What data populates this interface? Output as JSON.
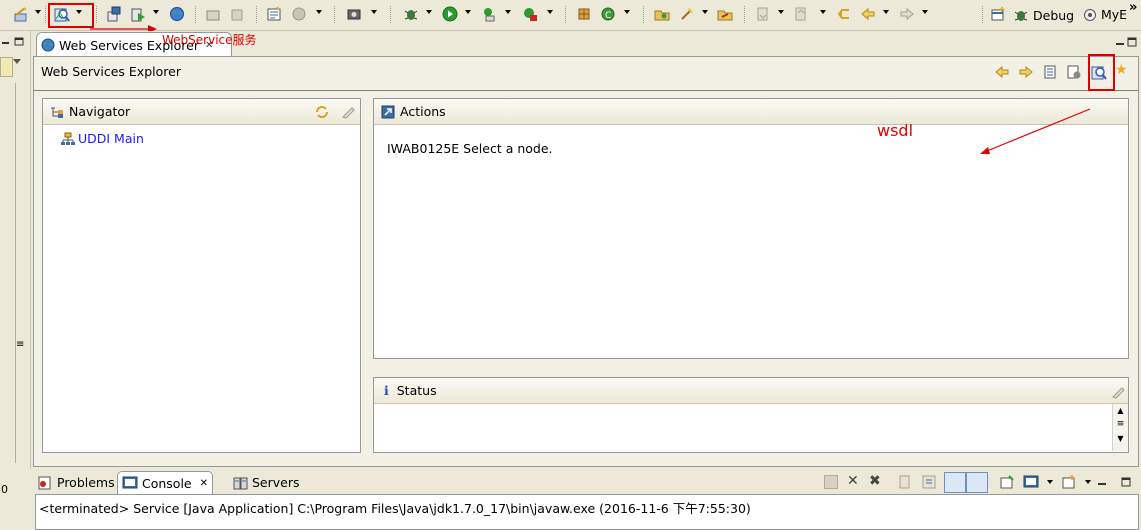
{
  "toolbar": {
    "perspectives": {
      "debug_label": "Debug",
      "mye_label": "MyE",
      "overflow_label": "»"
    },
    "icons": [
      "new-wizard-icon",
      "web-services-explorer-icon",
      "deploy-icon",
      "run-server-icon",
      "globe-icon",
      "debug-icon",
      "run-icon",
      "external-tools-icon",
      "coverage-icon",
      "open-type-icon",
      "open-task-icon",
      "annotation-icon",
      "back-icon",
      "forward-icon"
    ]
  },
  "editor": {
    "tab_title": "Web Services Explorer",
    "tab_close": "✕",
    "header_title": "Web Services Explorer",
    "navigator": {
      "title": "Navigator",
      "tree": [
        {
          "label": "UDDI Main"
        }
      ]
    },
    "actions": {
      "title": "Actions",
      "message": "IWAB0125E Select a node."
    },
    "status": {
      "title": "Status",
      "info_glyph": "i"
    }
  },
  "bottom": {
    "tabs": [
      {
        "label": "Problems"
      },
      {
        "label": "Console",
        "active": true
      },
      {
        "label": "Servers"
      }
    ],
    "console_close": "✕",
    "console_text": "<terminated> Service [Java Application] C:\\Program Files\\Java\\jdk1.7.0_17\\bin\\javaw.exe (2016-11-6 下午7:55:30)"
  },
  "annotations": {
    "webservice_note": "WebService服务",
    "wsdl_note": "wsdl",
    "left_edge_text": "0",
    "color": "#e00000"
  },
  "colors": {
    "link": "#1a1aff",
    "annotation": "#e00000",
    "chrome_bg": "#ece9d8"
  }
}
